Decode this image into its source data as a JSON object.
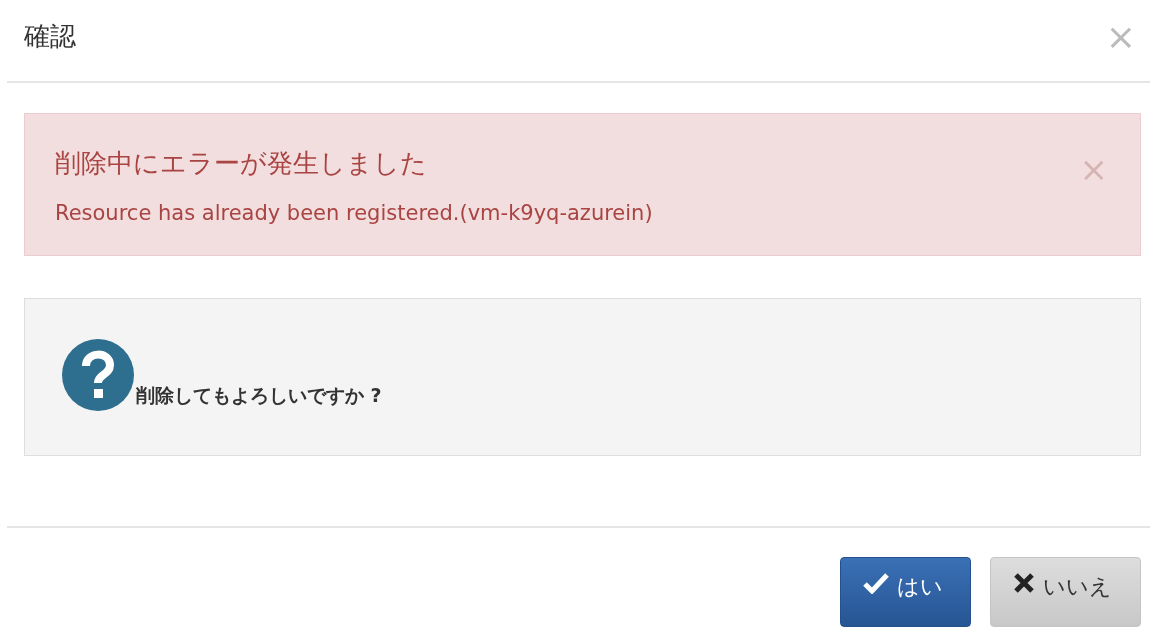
{
  "dialog": {
    "title": "確認",
    "close": "×"
  },
  "alert": {
    "title": "削除中にエラーが発生しました",
    "message": "Resource has already been registered.(vm-k9yq-azurein)",
    "close": "×"
  },
  "question": {
    "text": "削除してもよろしいですか ?"
  },
  "buttons": [
    {
      "kind": "primary",
      "label": "はい"
    },
    {
      "kind": "default",
      "label": "いいえ"
    }
  ]
}
